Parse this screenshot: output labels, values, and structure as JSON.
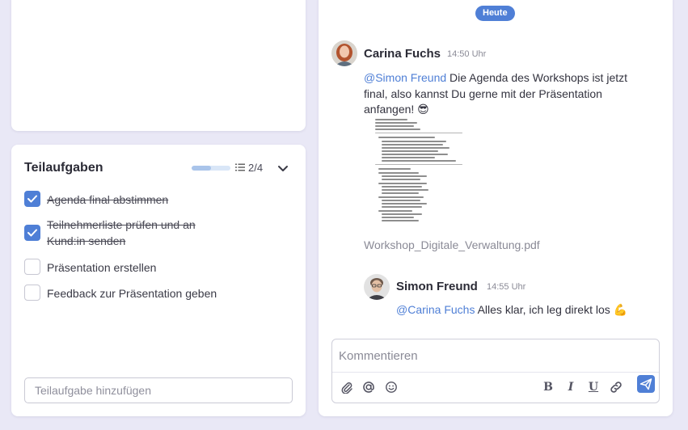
{
  "subtasks": {
    "title": "Teilaufgaben",
    "progress": 0.5,
    "count": "2/4",
    "items": [
      {
        "label": "Agenda final abstimmen",
        "done": true
      },
      {
        "label": "Teilnehmerliste prüfen und an Kund:in senden",
        "done": true
      },
      {
        "label": "Präsentation erstellen",
        "done": false
      },
      {
        "label": "Feedback zur Präsentation geben",
        "done": false
      }
    ],
    "add_placeholder": "Teilaufgabe hinzufügen"
  },
  "chat": {
    "date_label": "Heute",
    "messages": [
      {
        "author": "Carina Fuchs",
        "time": "14:50 Uhr",
        "mention": "@Simon Freund",
        "text": " Die Agenda des Workshops ist jetzt final, also kannst Du gerne mit der Präsentation anfangen! 😎",
        "attachment": "Workshop_Digitale_Verwaltung.pdf"
      },
      {
        "author": "Simon Freund",
        "time": "14:55 Uhr",
        "mention": "@Carina Fuchs",
        "text": " Alles klar, ich leg direkt los 💪"
      }
    ],
    "composer_placeholder": "Kommentieren",
    "toolbar": {
      "bold": "B",
      "italic": "I",
      "underline": "U"
    }
  },
  "colors": {
    "accent": "#4f7fd6",
    "background": "#e9e8f6"
  }
}
